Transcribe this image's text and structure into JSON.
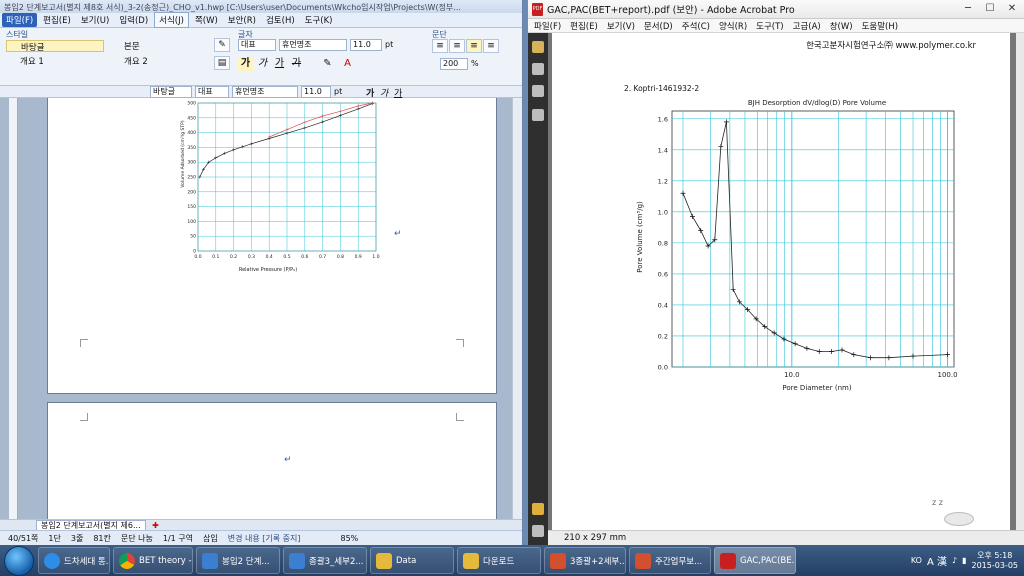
{
  "hwp": {
    "title": "봉입2 단계보고서(별지 제8호 서식)_3-2(송정근)_CHO_v1.hwp [C:\\Users\\user\\Documents\\Wkcho임시작업\\Projects\\W(정부...",
    "menus": [
      "파일(F)",
      "편집(E)",
      "보기(U)",
      "입력(D)",
      "서식(J)",
      "쪽(W)",
      "보안(R)",
      "검토(H)",
      "도구(K)"
    ],
    "ribbon": {
      "style_label": "스타일",
      "styles": [
        "바탕글",
        "본문",
        "개요 1",
        "개요 2"
      ],
      "font_label": "글자",
      "font_lang": "대표",
      "font_name": "휴먼명조",
      "font_size": "11.0",
      "font_unit": "pt",
      "fmt_buttons": [
        "가",
        "가",
        "가",
        "가"
      ],
      "para_label": "문단",
      "zoom": "200",
      "zoom_unit": "%"
    },
    "toolbar2": {
      "style": "바탕글",
      "font_lang": "대표",
      "font_name": "휴먼명조",
      "font_size": "11.0",
      "font_unit": "pt",
      "fmt": [
        "가",
        "가",
        "가"
      ]
    },
    "chart_text": {
      "ylabel": "Volume Adsorbed (cm³/g STP)",
      "xlabel": "Relative Pressure (P/P₀)",
      "yticks": [
        "500",
        "450",
        "400",
        "350",
        "300",
        "250",
        "200",
        "150",
        "100",
        "50",
        "0"
      ],
      "xticks": [
        "0.0",
        "0.1",
        "0.2",
        "0.3",
        "0.4",
        "0.5",
        "0.6",
        "0.7",
        "0.8",
        "0.9",
        "1.0"
      ]
    },
    "tab_name": "봉입2 단계보고서(별지 제6...",
    "status": {
      "page": "40/51쪽",
      "section": "1단",
      "line": "3줄",
      "col": "81칸",
      "split": "문단 나눔",
      "zone": "1/1 구역",
      "insert": "삽입",
      "track": "변경 내용 [기록 중지]",
      "zoom": "85%"
    }
  },
  "acrobat": {
    "title": "GAC,PAC(BET+report).pdf (보안) - Adobe Acrobat Pro",
    "menus": [
      "파일(F)",
      "편집(E)",
      "보기(V)",
      "문서(D)",
      "주석(C)",
      "양식(R)",
      "도구(T)",
      "고급(A)",
      "창(W)",
      "도움말(H)"
    ],
    "page_header": "한국고분자시험연구소㈜ www.polymer.co.kr",
    "sample_id": "2. Koptri-1461932-2",
    "page_size": "210 x 297 mm"
  },
  "chart_data": [
    {
      "type": "line",
      "title": "BJH Desorption dV/dlog(D) Pore Volume",
      "xlabel": "Pore Diameter (nm)",
      "ylabel": "Pore Volume (cm³/g)",
      "xscale": "log",
      "xlim": [
        1.7,
        110
      ],
      "ylim": [
        0,
        1.65
      ],
      "xticks": [
        "10.0",
        "100.0"
      ],
      "yticks": [
        "0.0",
        "0.2",
        "0.4",
        "0.6",
        "0.8",
        "1.0",
        "1.2",
        "1.4",
        "1.6"
      ],
      "grid": true,
      "x": [
        2.0,
        2.3,
        2.6,
        2.9,
        3.2,
        3.5,
        3.8,
        4.2,
        4.6,
        5.2,
        5.9,
        6.7,
        7.7,
        8.9,
        10.5,
        12.5,
        15.0,
        18.0,
        21.0,
        25.0,
        32.0,
        42.0,
        60.0,
        100.0
      ],
      "y": [
        1.12,
        0.97,
        0.88,
        0.78,
        0.82,
        1.42,
        1.58,
        0.5,
        0.42,
        0.37,
        0.31,
        0.26,
        0.22,
        0.18,
        0.15,
        0.12,
        0.1,
        0.1,
        0.11,
        0.08,
        0.06,
        0.06,
        0.07,
        0.08
      ]
    },
    {
      "type": "line",
      "title": "",
      "xlabel": "Relative Pressure (P/P₀)",
      "ylabel": "Volume Adsorbed (cm³/g STP)",
      "xlim": [
        0,
        1.0
      ],
      "ylim": [
        0,
        500
      ],
      "grid": true,
      "series": [
        {
          "x": [
            0.01,
            0.03,
            0.06,
            0.1,
            0.15,
            0.2,
            0.25,
            0.3,
            0.4,
            0.5,
            0.6,
            0.7,
            0.8,
            0.9,
            0.98
          ],
          "y": [
            250,
            275,
            300,
            315,
            330,
            342,
            352,
            362,
            380,
            398,
            416,
            436,
            458,
            480,
            498
          ]
        },
        {
          "x": [
            0.4,
            0.5,
            0.6,
            0.7,
            0.8,
            0.9,
            0.98
          ],
          "y": [
            385,
            410,
            435,
            456,
            472,
            490,
            500
          ]
        }
      ]
    }
  ],
  "taskbar": {
    "items": [
      "",
      "",
      "BET theory -...",
      "봉입2 단계...",
      "종괄3_세부2...",
      "Data",
      "다운로드",
      "3종괄+2세부...",
      "주간업무보...",
      "GAC,PAC(BE..."
    ],
    "ie_label": "드차세대 통...",
    "lang": "KO",
    "ime": "A 漢",
    "time_ampm": "오후 5:18",
    "date": "2015-03-05"
  }
}
